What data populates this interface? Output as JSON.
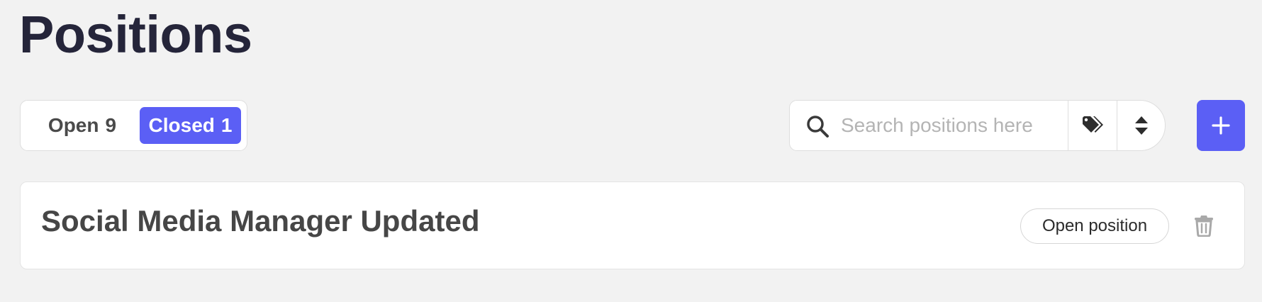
{
  "page": {
    "title": "Positions"
  },
  "filters": {
    "open_label": "Open",
    "open_count": "9",
    "closed_label": "Closed",
    "closed_count": "1",
    "active": "closed"
  },
  "search": {
    "placeholder": "Search positions here",
    "value": "",
    "search_icon": "search-icon",
    "tags_icon": "tags-icon",
    "sort_icon": "sort-icon"
  },
  "add_button": {
    "icon": "plus-icon"
  },
  "positions": [
    {
      "title": "Social Media Manager Updated",
      "action_label": "Open position",
      "delete_icon": "trash-icon"
    }
  ],
  "colors": {
    "accent": "#5b5ff5",
    "background": "#f2f2f2",
    "title_text": "#25253a"
  }
}
